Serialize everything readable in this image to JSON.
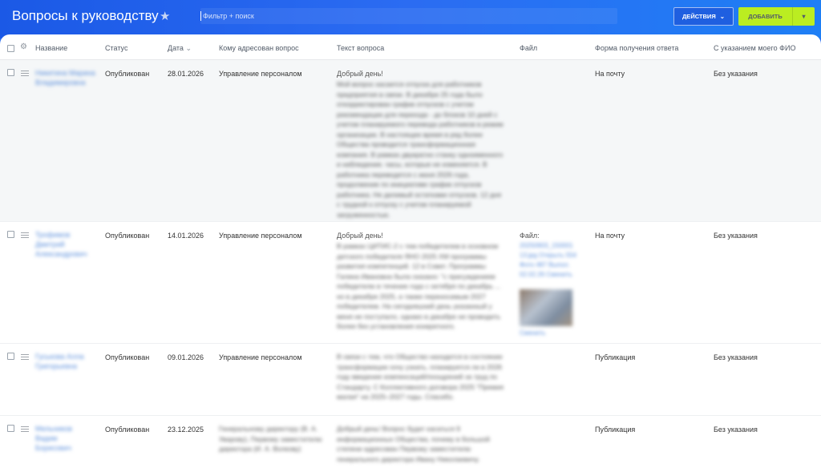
{
  "header": {
    "title": "Вопросы к руководству",
    "search_placeholder": "Фильтр + поиск",
    "actions_label": "Действия",
    "add_label": "Добавить"
  },
  "columns": {
    "name": "Название",
    "status": "Статус",
    "date": "Дата",
    "addressee": "Кому адресован вопрос",
    "text": "Текст вопроса",
    "file": "Файл",
    "answer_form": "Форма получения ответа",
    "with_name": "С указанием моего ФИО"
  },
  "rows": [
    {
      "name": "Никитина Марина Владимировна",
      "status": "Опубликован",
      "date": "28.01.2026",
      "addressee": "Управление персоналом",
      "greeting": "Добрый день!",
      "text": "Мой вопрос касается отпуска для работников предприятия в связи. В декабре 25 года было откорректирован график отпусков с учетом рекомендации для перехода - до блоков 10 дней с учетом планируемого перевода работников в режим организации. В настоящее время в ряд более Общества проводится трансформационная компания. В рамках двукратно станку одноименного и наблюдение. часы, которые не изменяется. В работника переводятся с июня 2026 года, продолжение по инициативе график отпусков работника. Не делимый остатками отпусков. 12 дня с трудной к отпуску с учетом планируемой загруженностью.",
      "file": "",
      "answer_form": "На почту",
      "with_name": "Без указания"
    },
    {
      "name": "Трофимов Дмитрий Александрович",
      "status": "Опубликован",
      "date": "14.01.2026",
      "addressee": "Управление персоналом",
      "greeting": "Добрый день!",
      "text": "В рамках ЦИТИС-2 с тем победителем в основном детского победителя ЯНО 2025 ХМ программы развития компетенций. 12 в Совет. Программы Галина Ивановна была сказано: \"с присуждением победителю в течение года с октября по декабрь ... но в декабре 2025, а также переносимым 2027 победителем. На сегодняшний день указанный у меня не поступало, однако в декабре не проводить более без установления конкретного.",
      "file_label": "Файл:",
      "file": "20250903_150001 13.jpg Открыть 554 Фото 487 Выпол. 02.02.26 Сменить",
      "file_action": "Сменить",
      "answer_form": "На почту",
      "with_name": "Без указания"
    },
    {
      "name": "Гуськова Алла Григорьевна",
      "status": "Опубликован",
      "date": "09.01.2026",
      "addressee": "Управление персоналом",
      "greeting": "",
      "text": "В связи с тем, что Общество находится в состоянии трансформации хочу узнать, планируется ли в 2026 году введение компенсаций/поощрений за труд по Стандарту. С Коллективного договора 2025 \"Премия малая\" на 2025–2027 годы. Спасибо.",
      "file": "",
      "answer_form": "Публикация",
      "with_name": "Без указания"
    },
    {
      "name": "Мельников Вадим Борисович",
      "status": "Опубликован",
      "date": "23.12.2025",
      "addressee": "Генеральному директору (В. А. Уварову), Первому заместителю директора (И. А. Волкову)",
      "greeting": "",
      "text": "Добрый день! Вопрос будет касаться 9 информационных Общества, почему в большой степени адресован Первому заместителю генерального директора Ивану Николаевичу.",
      "file": "",
      "answer_form": "Публикация",
      "with_name": "Без указания"
    }
  ]
}
